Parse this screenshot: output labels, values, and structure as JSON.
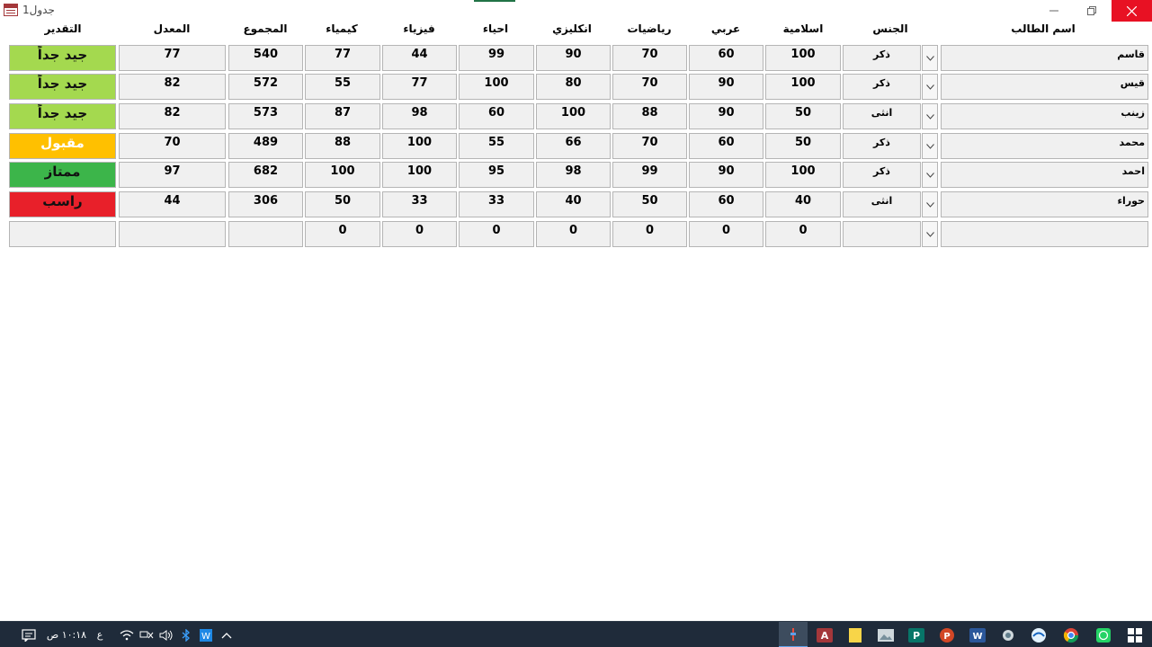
{
  "window": {
    "title": "جدول1"
  },
  "headers": {
    "name": "اسم الطالب",
    "gender": "الجنس",
    "islamic": "اسلامية",
    "arabic": "عربي",
    "math": "رياضيات",
    "english": "انكليزي",
    "biology": "احياء",
    "physics": "فيزياء",
    "chemistry": "كيمياء",
    "total": "المجموع",
    "average": "المعدل",
    "grade": "التقدير"
  },
  "rows": [
    {
      "name": "قاسم",
      "gender": "ذكر",
      "islamic": "100",
      "arabic": "60",
      "math": "70",
      "english": "90",
      "biology": "99",
      "physics": "44",
      "chemistry": "77",
      "total": "540",
      "average": "77",
      "grade": "جيد جداً",
      "grade_color": "#a4d94f"
    },
    {
      "name": "قيس",
      "gender": "ذكر",
      "islamic": "100",
      "arabic": "90",
      "math": "70",
      "english": "80",
      "biology": "100",
      "physics": "77",
      "chemistry": "55",
      "total": "572",
      "average": "82",
      "grade": "جيد جداً",
      "grade_color": "#a4d94f"
    },
    {
      "name": "زينب",
      "gender": "انثى",
      "islamic": "50",
      "arabic": "90",
      "math": "88",
      "english": "100",
      "biology": "60",
      "physics": "98",
      "chemistry": "87",
      "total": "573",
      "average": "82",
      "grade": "جيد جداً",
      "grade_color": "#a4d94f"
    },
    {
      "name": "محمد",
      "gender": "ذكر",
      "islamic": "50",
      "arabic": "60",
      "math": "70",
      "english": "66",
      "biology": "55",
      "physics": "100",
      "chemistry": "88",
      "total": "489",
      "average": "70",
      "grade": "مقبول",
      "grade_color": "#ffc000"
    },
    {
      "name": "احمد",
      "gender": "ذكر",
      "islamic": "100",
      "arabic": "90",
      "math": "99",
      "english": "98",
      "biology": "95",
      "physics": "100",
      "chemistry": "100",
      "total": "682",
      "average": "97",
      "grade": "ممتاز",
      "grade_color": "#3cb54a"
    },
    {
      "name": "حوراء",
      "gender": "انثى",
      "islamic": "40",
      "arabic": "60",
      "math": "50",
      "english": "40",
      "biology": "33",
      "physics": "33",
      "chemistry": "50",
      "total": "306",
      "average": "44",
      "grade": "راسب",
      "grade_color": "#e8202a"
    },
    {
      "name": "",
      "gender": "",
      "islamic": "0",
      "arabic": "0",
      "math": "0",
      "english": "0",
      "biology": "0",
      "physics": "0",
      "chemistry": "0",
      "total": "",
      "average": "",
      "grade": "",
      "grade_color": "#f0f0f0"
    }
  ],
  "taskbar": {
    "time": "١٠:١٨ ص",
    "language": "ع",
    "apps": [
      "access-icon",
      "notes-icon",
      "image-viewer-icon",
      "publisher-icon",
      "powerpoint-icon",
      "word-icon",
      "settings-icon",
      "media-icon",
      "chrome-icon",
      "whatsapp-icon"
    ]
  }
}
